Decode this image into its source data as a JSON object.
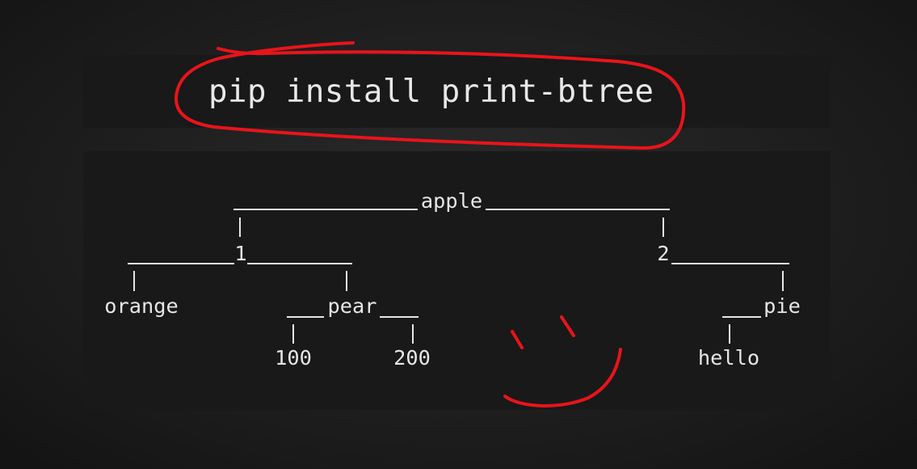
{
  "command": {
    "text": "pip install print-btree"
  },
  "tree": {
    "root": "apple",
    "left": {
      "label": "1",
      "left": "orange",
      "right": {
        "label": "pear",
        "left": "100",
        "right": "200"
      }
    },
    "right": {
      "label": "2",
      "right": {
        "label": "pie",
        "left": "hello"
      }
    }
  },
  "annotation": {
    "color": "#e8141b",
    "shapes": [
      "circle-around-command",
      "smiley-face"
    ]
  }
}
